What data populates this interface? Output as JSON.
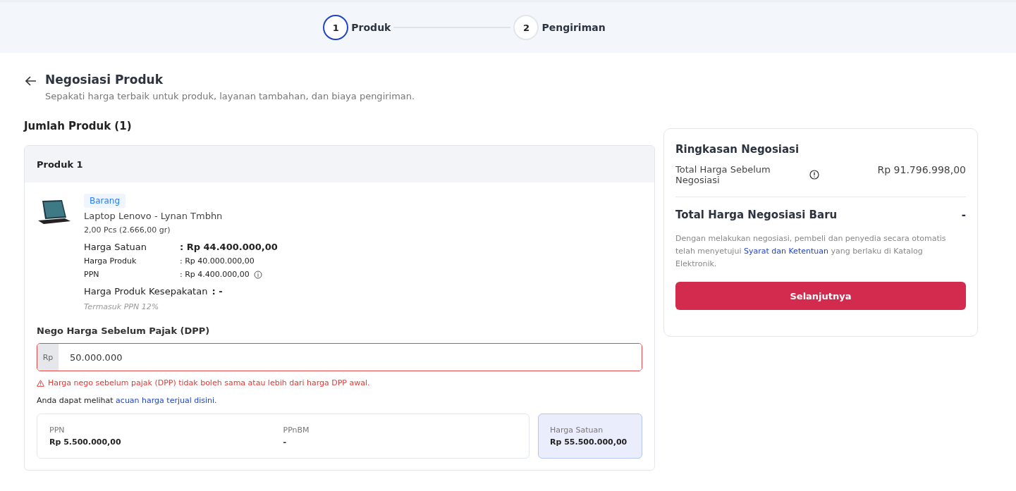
{
  "stepper": [
    {
      "number": "1",
      "label": "Produk",
      "selected": true
    },
    {
      "number": "2",
      "label": "Pengiriman",
      "selected": false
    }
  ],
  "header": {
    "title": "Negosiasi Produk",
    "subtitle": "Sepakati harga terbaik untuk produk, layanan tambahan, dan biaya pengiriman."
  },
  "product_count": "Jumlah Produk (1)",
  "product_card": {
    "title": "Produk 1",
    "tag": "Barang",
    "name": "Laptop Lenovo - Lynan Tmbhn",
    "quantity": "2,00 Pcs (2.666,00 gr)",
    "prices": [
      {
        "kind": "main",
        "label": "Harga Satuan",
        "value": ": Rp 44.400.000,00",
        "info": false
      },
      {
        "kind": "sub",
        "label": "Harga Produk",
        "value": ": Rp 40.000.000,00",
        "info": false
      },
      {
        "kind": "sub",
        "label": "PPN",
        "value": ": Rp 4.400.000,00",
        "info": true
      },
      {
        "kind": "agreed",
        "label": "Harga Produk Kesepakatan",
        "value": ": -",
        "info": false
      }
    ],
    "tax_note": "Termasuk PPN 12%",
    "nego_label": "Nego Harga Sebelum Pajak (DPP)",
    "currency": "Rp",
    "nego_value": "50.000.000",
    "error": "Harga nego sebelum pajak (DPP) tidak boleh sama atau lebih dari harga DPP awal.",
    "reference": {
      "before": "Anda dapat melihat ",
      "link": "acuan harga terjual disini."
    },
    "taxes": [
      {
        "label": "PPN",
        "value": "Rp 5.500.000,00"
      },
      {
        "label": "PPnBM",
        "value": "-"
      }
    ],
    "unit_price": {
      "label": "Harga Satuan",
      "value": "Rp 55.500.000,00"
    }
  },
  "summary": {
    "title": "Ringkasan Negosiasi",
    "before_label": "Total Harga Sebelum Negosiasi",
    "before_value": "Rp 91.796.998,00",
    "new_label": "Total Harga Negosiasi Baru",
    "new_value": "-",
    "terms": {
      "before": "Dengan melakukan negosiasi, pembeli dan penyedia secara otomatis telah menyetujui ",
      "link": "Syarat dan Ketentuan",
      "after": " yang berlaku di Katalog Elektronik."
    },
    "button": "Selanjutnya"
  }
}
